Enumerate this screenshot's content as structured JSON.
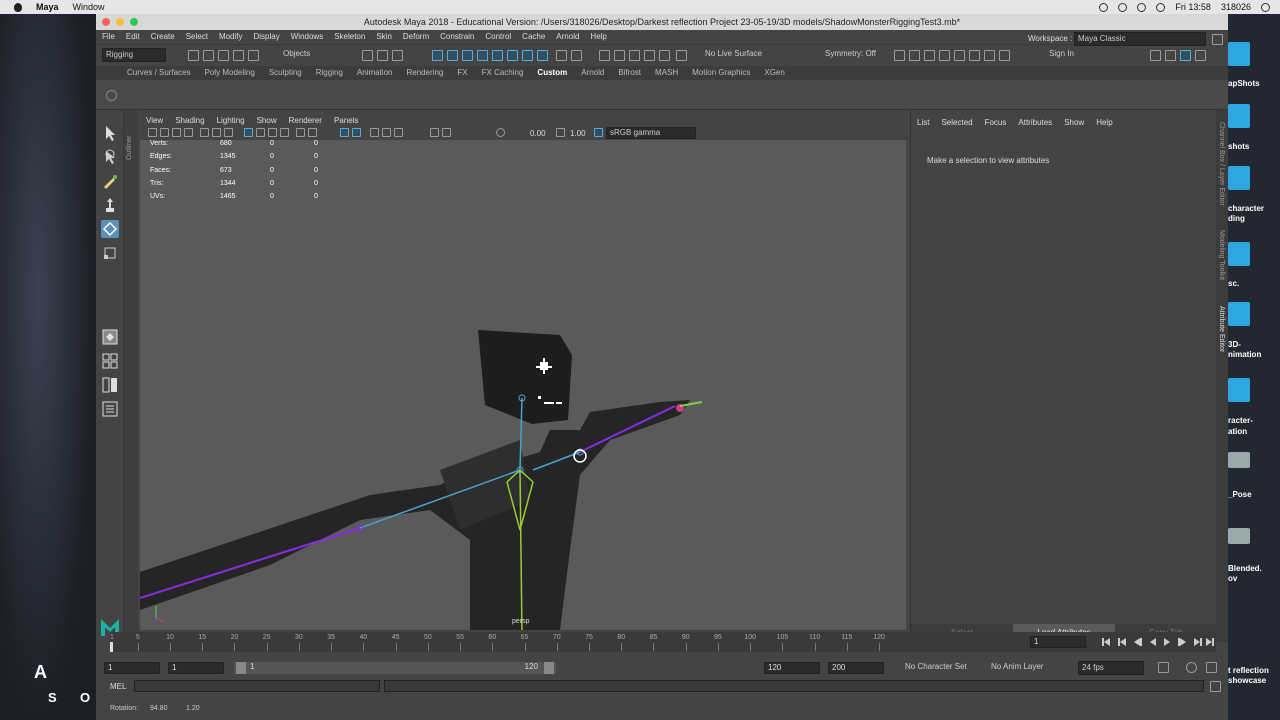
{
  "menubar": {
    "app": "Maya",
    "items": [
      "Window"
    ],
    "time": "Fri 13:58",
    "user": "318026"
  },
  "window": {
    "title": "Autodesk Maya 2018 - Educational Version: /Users/318026/Desktop/Darkest reflection Project 23-05-19/3D models/ShadowMonsterRiggingTest3.mb*"
  },
  "main_menu": [
    "File",
    "Edit",
    "Create",
    "Select",
    "Modify",
    "Display",
    "Windows",
    "Skeleton",
    "Skin",
    "Deform",
    "Constrain",
    "Control",
    "Cache",
    "Arnold",
    "Help"
  ],
  "status_line": {
    "menu_set": "Rigging",
    "select_mode": "Objects",
    "live_surface": "No Live Surface",
    "symmetry": "Symmetry: Off",
    "sign_in": "Sign In",
    "workspace_label": "Workspace :",
    "workspace": "Maya Classic"
  },
  "shelf_tabs": [
    "Curves / Surfaces",
    "Poly Modeling",
    "Sculpting",
    "Rigging",
    "Animation",
    "Rendering",
    "FX",
    "FX Caching",
    "Custom",
    "Arnold",
    "Bifrost",
    "MASH",
    "Motion Graphics",
    "XGen"
  ],
  "active_shelf": "Custom",
  "viewport_menu": [
    "View",
    "Shading",
    "Lighting",
    "Show",
    "Renderer",
    "Panels"
  ],
  "viewport_toolbar": {
    "exposure": "0.00",
    "gamma": "1.00",
    "color_space": "sRGB gamma"
  },
  "hud": [
    {
      "label": "Verts:",
      "v1": "680",
      "v2": "0",
      "v3": "0"
    },
    {
      "label": "Edges:",
      "v1": "1345",
      "v2": "0",
      "v3": "0"
    },
    {
      "label": "Faces:",
      "v1": "673",
      "v2": "0",
      "v3": "0"
    },
    {
      "label": "Tris:",
      "v1": "1344",
      "v2": "0",
      "v3": "0"
    },
    {
      "label": "UVs:",
      "v1": "1465",
      "v2": "0",
      "v3": "0"
    }
  ],
  "camera_label": "persp",
  "outliner_label": "Outliner",
  "attribute_editor": {
    "menu": [
      "List",
      "Selected",
      "Focus",
      "Attributes",
      "Show",
      "Help"
    ],
    "message": "Make a selection to view attributes",
    "buttons": [
      "Select",
      "Load Attributes",
      "Copy Tab"
    ]
  },
  "side_tabs": [
    "Channel Box / Layer Editor",
    "Modeling Toolkit",
    "Attribute Editor"
  ],
  "timeline": {
    "ticks": [
      "1",
      "5",
      "10",
      "15",
      "20",
      "25",
      "30",
      "35",
      "40",
      "45",
      "50",
      "55",
      "60",
      "65",
      "70",
      "75",
      "80",
      "85",
      "90",
      "95",
      "100",
      "105",
      "110",
      "115",
      "120"
    ],
    "current_frame": "1"
  },
  "range": {
    "start": "1",
    "anim_start": "1",
    "range_start": "1",
    "range_end": "120",
    "anim_end": "120",
    "end": "200",
    "character_set": "No Character Set",
    "anim_layer": "No Anim Layer",
    "fps": "24 fps"
  },
  "command_line": {
    "lang": "MEL"
  },
  "help_line": {
    "label": "Rotation:",
    "v1": "94.80",
    "v2": "1.20"
  },
  "desktop_right": [
    "apShots",
    "shots",
    "character",
    "ding",
    "sc.",
    "3D-",
    "nimation",
    "racter-",
    "ation",
    "_Pose",
    "Blended.",
    "ov",
    "t reflection",
    "showcase"
  ],
  "desktop_left": [
    "A",
    "S",
    "O"
  ]
}
